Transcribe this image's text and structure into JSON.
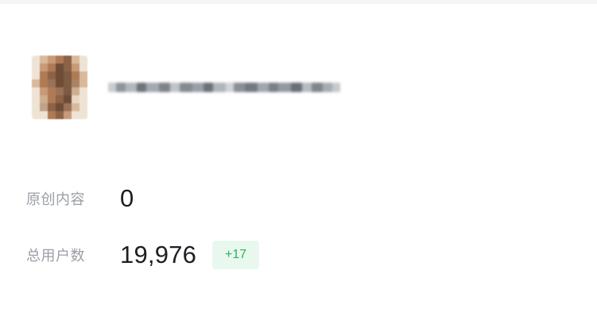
{
  "account": {
    "avatar_name": "avatar-image",
    "name_blurred": true
  },
  "stats": {
    "original_content": {
      "label": "原创内容",
      "value": "0"
    },
    "total_users": {
      "label": "总用户数",
      "value": "19,976",
      "delta": "+17"
    }
  },
  "colors": {
    "label": "#9a9ea6",
    "value": "#1d1f23",
    "badge_bg": "#e9f8ee",
    "badge_text": "#2bb35c"
  }
}
